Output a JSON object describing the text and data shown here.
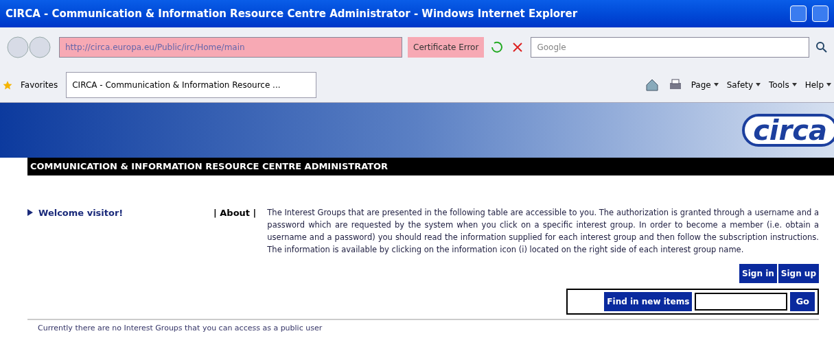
{
  "window": {
    "title": "CIRCA - Communication & Information Resource Centre Administrator - Windows Internet Explorer"
  },
  "address": {
    "value": "http://circa.europa.eu/Public/irc/Home/main",
    "warning": "Certificate Error"
  },
  "search": {
    "placeholder": "Google"
  },
  "favorites": {
    "label": "Favorites"
  },
  "tab": {
    "label": "CIRCA - Communication & Information Resource ...",
    "selected": true
  },
  "commands": [
    "Page",
    "Safety",
    "Tools",
    "Help"
  ],
  "banner": {
    "logo": "circa",
    "heading": "COMMUNICATION & INFORMATION RESOURCE CENTRE ADMINISTRATOR"
  },
  "sidebar": {
    "link": "Welcome visitor!"
  },
  "about": {
    "label": "| About |",
    "text": "The Interest Groups that are presented in the following table are accessible to you. The authorization is granted through a username and a password which are requested by the system when you click on a specific interest group. In order to become a member (i.e. obtain a username and a password) you should read the information supplied for each interest group and then follow the subscription instructions. The information is available by clicking on the information icon (i) located on the right side of each interest group name."
  },
  "buttons": [
    "Sign in",
    "Sign up"
  ],
  "find": {
    "label": "Find in new items",
    "button": "Go"
  },
  "message": "Currently there are no Interest Groups that you can access as a public user"
}
